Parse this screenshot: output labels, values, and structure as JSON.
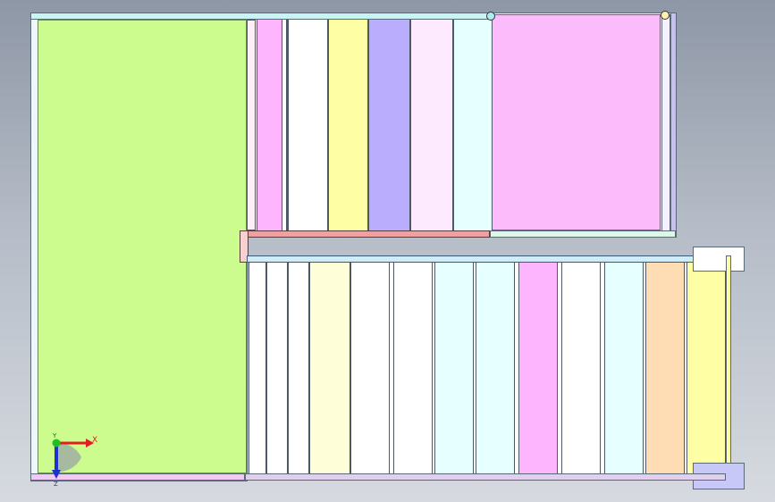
{
  "viewport": {
    "axes": {
      "x_label": "X",
      "y_label": "Y",
      "z_label": "Z"
    },
    "colors": {
      "left_slab": "#ccfc8e",
      "upper_right_slab": "#fcbcfc",
      "outer_frame": "#e6f4ff",
      "top_rail": "#c8f4f4",
      "mid_rail": "#f0a0a0",
      "axis_x": "#e02020",
      "axis_y": "#20c020",
      "axis_z": "#2030d0"
    },
    "top_row_panels": [
      "#fdb5fd",
      "#ffffff",
      "#fefea4",
      "#bbadfd",
      "#feeafe",
      "#e6ffff"
    ],
    "bottom_row_panels": [
      "#ffffff",
      "#ffffff",
      "#fefed8",
      "#ffffff",
      "#ffffff",
      "#e6ffff",
      "#e6ffff",
      "#fdb5fd",
      "#ffffff",
      "#e6ffff",
      "#fedcb4",
      "#fefea4"
    ]
  }
}
